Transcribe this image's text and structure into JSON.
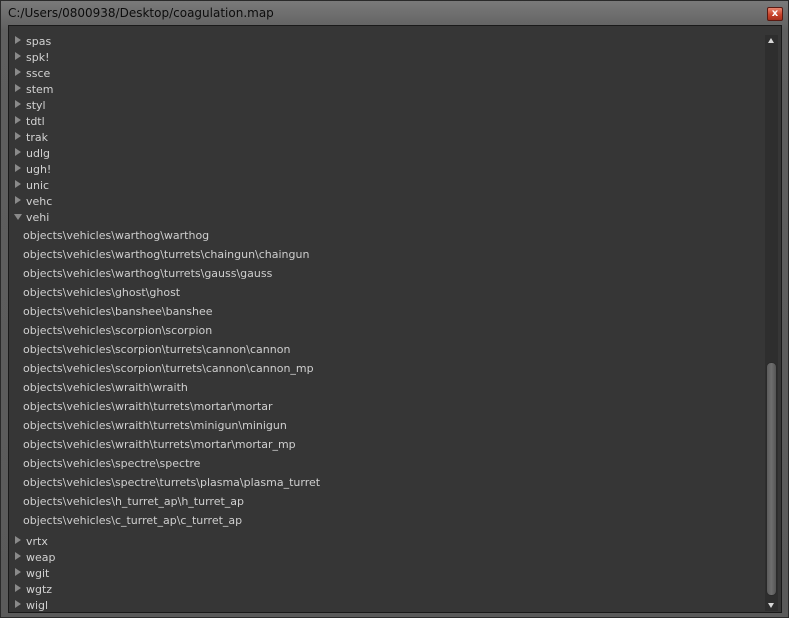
{
  "window": {
    "title": "C:/Users/0800938/Desktop/coagulation.map",
    "close_glyph": "x"
  },
  "tree": {
    "nodes_before": [
      "spas",
      "spk!",
      "ssce",
      "stem",
      "styl",
      "tdtl",
      "trak",
      "udlg",
      "ugh!",
      "unic",
      "vehc"
    ],
    "expanded_node": {
      "label": "vehi",
      "children": [
        "objects\\vehicles\\warthog\\warthog",
        "objects\\vehicles\\warthog\\turrets\\chaingun\\chaingun",
        "objects\\vehicles\\warthog\\turrets\\gauss\\gauss",
        "objects\\vehicles\\ghost\\ghost",
        "objects\\vehicles\\banshee\\banshee",
        "objects\\vehicles\\scorpion\\scorpion",
        "objects\\vehicles\\scorpion\\turrets\\cannon\\cannon",
        "objects\\vehicles\\scorpion\\turrets\\cannon\\cannon_mp",
        "objects\\vehicles\\wraith\\wraith",
        "objects\\vehicles\\wraith\\turrets\\mortar\\mortar",
        "objects\\vehicles\\wraith\\turrets\\minigun\\minigun",
        "objects\\vehicles\\wraith\\turrets\\mortar\\mortar_mp",
        "objects\\vehicles\\spectre\\spectre",
        "objects\\vehicles\\spectre\\turrets\\plasma\\plasma_turret",
        "objects\\vehicles\\h_turret_ap\\h_turret_ap",
        "objects\\vehicles\\c_turret_ap\\c_turret_ap"
      ]
    },
    "nodes_after": [
      "vrtx",
      "weap",
      "wgit",
      "wgtz",
      "wigl"
    ]
  },
  "icons": {
    "collapsed": "triangle-right-icon",
    "expanded": "triangle-down-icon"
  },
  "scrollbar": {
    "position_fraction": 0.57
  }
}
